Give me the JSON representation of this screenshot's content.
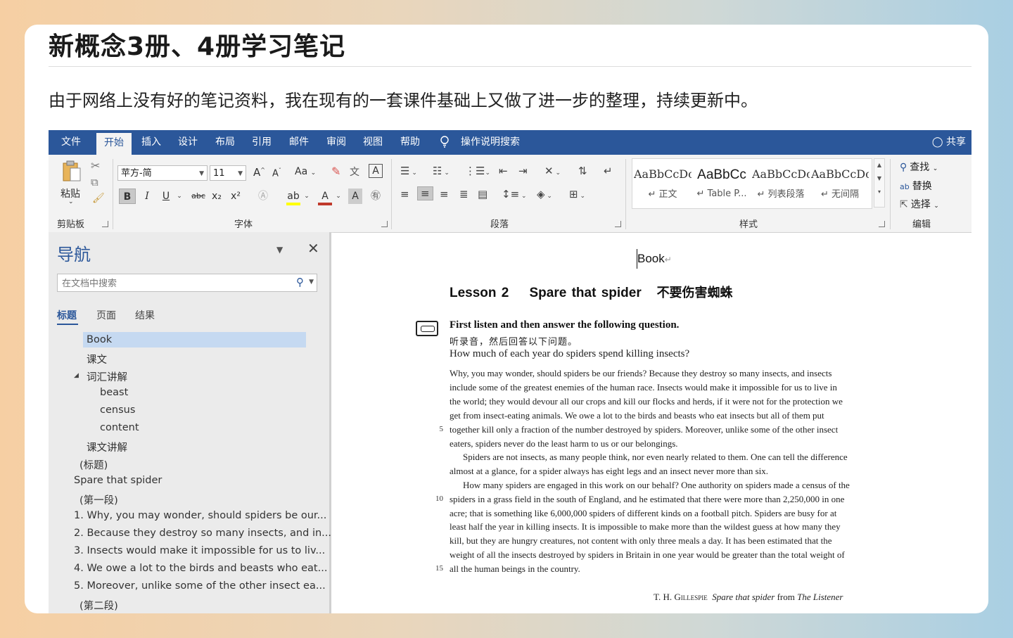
{
  "page": {
    "title": "新概念3册、4册学习笔记",
    "description": "由于网络上没有好的笔记资料，我在现有的一套课件基础上又做了进一步的整理，持续更新中。"
  },
  "menubar": {
    "tabs": [
      "文件",
      "开始",
      "插入",
      "设计",
      "布局",
      "引用",
      "邮件",
      "审阅",
      "视图",
      "帮助"
    ],
    "active_tab": "开始",
    "search_tip": "操作说明搜索",
    "share": "共享",
    "accent": "#2b579a"
  },
  "ribbon": {
    "clipboard": {
      "paste": "粘贴",
      "label": "剪贴板"
    },
    "font": {
      "family": "苹方-简",
      "size": "11",
      "grow": "A",
      "shrink": "A",
      "case": "Aa",
      "bold": "B",
      "italic": "I",
      "underline": "U",
      "strike": "abc",
      "subscript": "x₂",
      "superscript": "x²",
      "color_a": "A",
      "label": "字体"
    },
    "paragraph": {
      "label": "段落"
    },
    "styles": {
      "items": [
        {
          "sample": "AaBbCcDc",
          "name": "↵ 正文"
        },
        {
          "sample": "AaBbCc",
          "name": "↵ Table P..."
        },
        {
          "sample": "AaBbCcDc",
          "name": "↵ 列表段落"
        },
        {
          "sample": "AaBbCcDc",
          "name": "↵ 无间隔"
        }
      ],
      "label": "样式"
    },
    "editing": {
      "find": "查找",
      "replace": "替换",
      "select": "选择",
      "label": "编辑"
    }
  },
  "nav": {
    "title": "导航",
    "search_placeholder": "在文档中搜索",
    "tabs": [
      "标题",
      "页面",
      "结果"
    ],
    "items": [
      "Book",
      "课文",
      "词汇讲解",
      "beast",
      "census",
      "content",
      "课文讲解",
      "(标题)",
      "Spare that spider",
      "(第一段)",
      "1. Why, you may wonder, should spiders be our...",
      "2. Because they destroy so many insects, and in...",
      "3. Insects would make it impossible for us to liv...",
      "4. We owe a lot to the birds and beasts who eat...",
      "5. Moreover, unlike some of the other insect ea...",
      "(第二段)"
    ]
  },
  "document": {
    "heading": "Book",
    "lesson": {
      "num": "Lesson 2",
      "en": "Spare that spider",
      "cn": "不要伤害蜘蛛"
    },
    "q1": "First listen and then answer the following question.",
    "q2": "听录音，然后回答以下问题。",
    "q3": "How much of each year do spiders spend killing insects?",
    "lines": [
      "Why, you may wonder, should spiders be our friends? Because they destroy so many insects, and insects",
      "include some of the greatest enemies of the human race. Insects would make it impossible for us to live in",
      "the world; they would devour all our crops and kill our flocks and herds, if it were not for the protection we",
      "get from insect-eating animals. We owe a lot to the birds and beasts who eat insects but all of them put",
      "together kill only a fraction of the number destroyed by spiders. Moreover, unlike some of the other insect",
      "eaters, spiders never do the least harm to us or our belongings.",
      "Spiders are not insects, as many people think, nor even nearly related to them. One can tell the difference",
      "almost at a glance, for a spider always has eight legs and an insect never more than six.",
      "How many spiders are engaged in this work on our behalf? One authority on spiders made a census of the",
      "spiders in a grass field in the south of England, and he estimated that there were more than 2,250,000 in one",
      "acre; that is something like 6,000,000 spiders of different kinds on a football pitch. Spiders are busy for at",
      "least half the year in killing insects. It is impossible to make more than the wildest guess at how many they",
      "kill, but they are hungry creatures, not content with only three meals a day. It has been estimated that the",
      "weight of all the insects destroyed by spiders in Britain in one year would be greater than the total weight of",
      "all the human beings in the country."
    ],
    "line_numbers": {
      "l5": "5",
      "l10": "10",
      "l15": "15"
    },
    "credit": {
      "author": "T. H. Gillespie",
      "work": "Spare that spider",
      "from": "from",
      "source": "The Listener"
    }
  }
}
